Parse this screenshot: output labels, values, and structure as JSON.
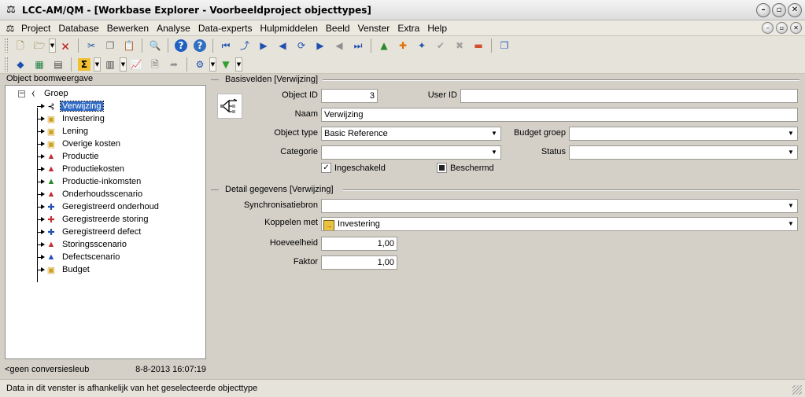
{
  "window": {
    "title": "LCC-AM/QM - [Workbase Explorer - Voorbeeldproject objecttypes]",
    "controls": [
      "minimize",
      "restore",
      "close"
    ]
  },
  "menubar": {
    "items": [
      "Project",
      "Database",
      "Bewerken",
      "Analyse",
      "Data-experts",
      "Hulpmiddelen",
      "Beeld",
      "Venster",
      "Extra",
      "Help"
    ]
  },
  "left_panel": {
    "title": "Object boomweergave",
    "tree": {
      "root": "Groep",
      "children": [
        {
          "label": "Verwijzing",
          "icon": "reference-icon",
          "selected": true
        },
        {
          "label": "Investering",
          "icon": "investment-icon"
        },
        {
          "label": "Lening",
          "icon": "loan-icon"
        },
        {
          "label": "Overige kosten",
          "icon": "other-costs-icon"
        },
        {
          "label": "Productie",
          "icon": "production-icon"
        },
        {
          "label": "Productiekosten",
          "icon": "production-costs-icon"
        },
        {
          "label": "Productie-inkomsten",
          "icon": "production-income-icon"
        },
        {
          "label": "Onderhoudsscenario",
          "icon": "maintenance-scenario-icon"
        },
        {
          "label": "Geregistreerd onderhoud",
          "icon": "registered-maintenance-icon"
        },
        {
          "label": "Geregistreerde storing",
          "icon": "registered-failure-icon"
        },
        {
          "label": "Geregistreerd defect",
          "icon": "registered-defect-icon"
        },
        {
          "label": "Storingsscenario",
          "icon": "failure-scenario-icon"
        },
        {
          "label": "Defectscenario",
          "icon": "defect-scenario-icon"
        },
        {
          "label": "Budget",
          "icon": "budget-icon"
        }
      ]
    },
    "footer_left": "<geen conversiesleub",
    "footer_right": "8-8-2013 16:07:19"
  },
  "basisvelden": {
    "title": "Basisvelden [Verwijzing]",
    "object_id_label": "Object ID",
    "object_id_value": "3",
    "user_id_label": "User ID",
    "user_id_value": "",
    "naam_label": "Naam",
    "naam_value": "Verwijzing",
    "object_type_label": "Object type",
    "object_type_value": "Basic Reference",
    "budget_groep_label": "Budget groep",
    "budget_groep_value": "",
    "categorie_label": "Categorie",
    "categorie_value": "",
    "status_label": "Status",
    "status_value": "",
    "ingeschakeld_label": "Ingeschakeld",
    "ingeschakeld_checked": true,
    "beschermd_label": "Beschermd",
    "beschermd_checked": true
  },
  "detail": {
    "title": "Detail gegevens [Verwijzing]",
    "synchronisatiebron_label": "Synchronisatiebron",
    "synchronisatiebron_value": "",
    "koppelen_label": "Koppelen met",
    "koppelen_value": "Investering",
    "hoeveelheid_label": "Hoeveelheid",
    "hoeveelheid_value": "1,00",
    "faktor_label": "Faktor",
    "faktor_value": "1,00"
  },
  "statusbar": {
    "text": "Data in dit venster is afhankelijk van het geselecteerde objecttype"
  }
}
